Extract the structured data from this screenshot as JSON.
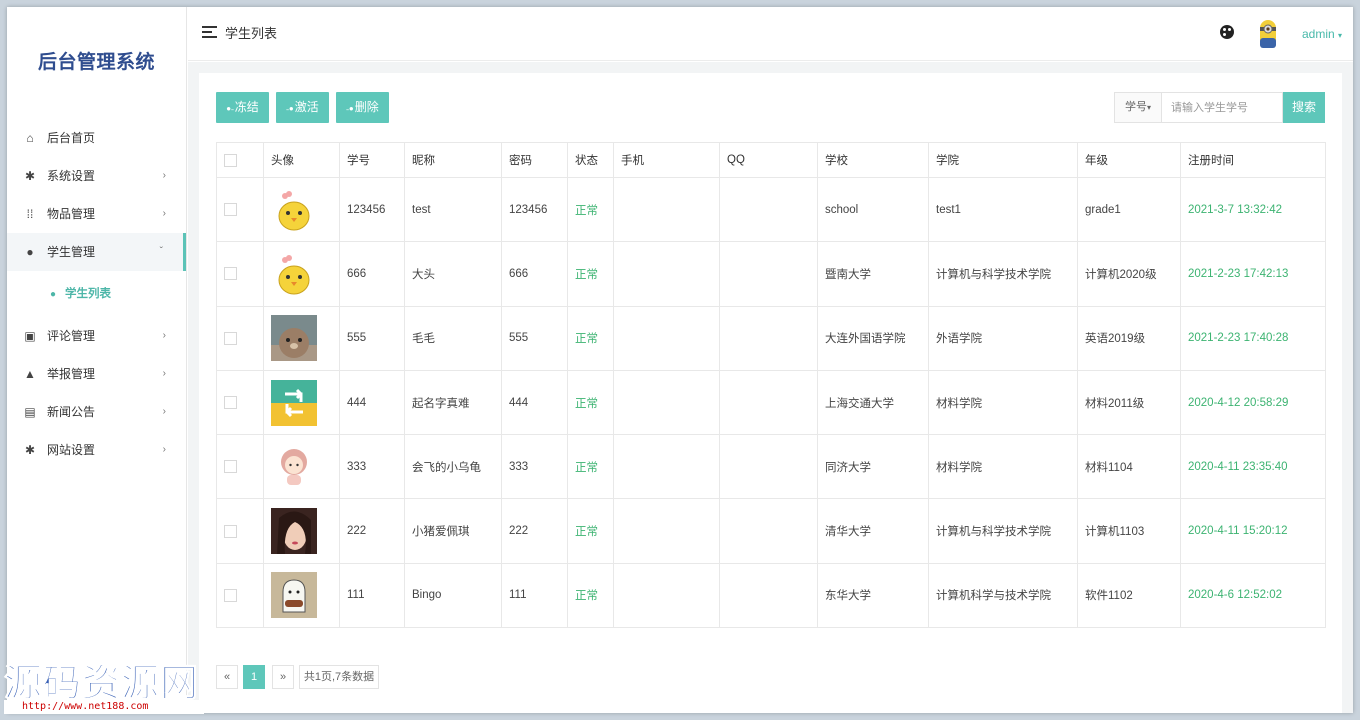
{
  "sidebar": {
    "brand": "后台管理系统",
    "items": [
      {
        "label": "后台首页",
        "icon": "home-icon",
        "glyph": "⌂",
        "arrow": ""
      },
      {
        "label": "系统设置",
        "icon": "gear-icon",
        "glyph": "✱",
        "arrow": "›"
      },
      {
        "label": "物品管理",
        "icon": "grid-icon",
        "glyph": "⁞⁞",
        "arrow": "›"
      },
      {
        "label": "学生管理",
        "icon": "users-icon",
        "glyph": "👥",
        "arrow": "ˇ"
      },
      {
        "label": "评论管理",
        "icon": "comment-icon",
        "glyph": "▣",
        "arrow": "›"
      },
      {
        "label": "举报管理",
        "icon": "warning-icon",
        "glyph": "▲",
        "arrow": "›"
      },
      {
        "label": "新闻公告",
        "icon": "news-icon",
        "glyph": "▤",
        "arrow": "›"
      },
      {
        "label": "网站设置",
        "icon": "gear-icon",
        "glyph": "✱",
        "arrow": "›"
      }
    ],
    "sub_item": {
      "label": "学生列表",
      "icon": "users-icon"
    }
  },
  "header": {
    "title": "学生列表",
    "user": "admin"
  },
  "toolbar": {
    "freeze": "冻结",
    "activate": "激活",
    "delete": "删除"
  },
  "search": {
    "type": "学号",
    "placeholder": "请输入学生学号",
    "button": "搜索"
  },
  "table": {
    "headers": [
      "",
      "头像",
      "学号",
      "昵称",
      "密码",
      "状态",
      "手机",
      "QQ",
      "学校",
      "学院",
      "年级",
      "注册时间"
    ],
    "rows": [
      {
        "avatar": "chick",
        "id": "123456",
        "nickname": "test",
        "password": "123456",
        "status": "正常",
        "phone": "",
        "qq": "",
        "school": "school",
        "college": "test1",
        "grade": "grade1",
        "regtime": "2021-3-7 13:32:42"
      },
      {
        "avatar": "chick",
        "id": "666",
        "nickname": "大头",
        "password": "666",
        "status": "正常",
        "phone": "",
        "qq": "",
        "school": "暨南大学",
        "college": "计算机与科学技术学院",
        "grade": "计算机2020级",
        "regtime": "2021-2-23 17:42:13"
      },
      {
        "avatar": "bear",
        "id": "555",
        "nickname": "毛毛",
        "password": "555",
        "status": "正常",
        "phone": "",
        "qq": "",
        "school": "大连外国语学院",
        "college": "外语学院",
        "grade": "英语2019级",
        "regtime": "2021-2-23 17:40:28"
      },
      {
        "avatar": "arrows",
        "id": "444",
        "nickname": "起名字真难",
        "password": "444",
        "status": "正常",
        "phone": "",
        "qq": "",
        "school": "上海交通大学",
        "college": "材料学院",
        "grade": "材料2011级",
        "regtime": "2020-4-12 20:58:29"
      },
      {
        "avatar": "girl",
        "id": "333",
        "nickname": "会飞的小乌龟",
        "password": "333",
        "status": "正常",
        "phone": "",
        "qq": "",
        "school": "同济大学",
        "college": "材料学院",
        "grade": "材料1104",
        "regtime": "2020-4-11 23:35:40"
      },
      {
        "avatar": "photo",
        "id": "222",
        "nickname": "小猪爱佩琪",
        "password": "222",
        "status": "正常",
        "phone": "",
        "qq": "",
        "school": "清华大学",
        "college": "计算机与科学技术学院",
        "grade": "计算机1103",
        "regtime": "2020-4-11 15:20:12"
      },
      {
        "avatar": "ghost",
        "id": "111",
        "nickname": "Bingo",
        "password": "111",
        "status": "正常",
        "phone": "",
        "qq": "",
        "school": "东华大学",
        "college": "计算机科学与技术学院",
        "grade": "软件1102",
        "regtime": "2020-4-6 12:52:02"
      }
    ]
  },
  "pagination": {
    "prev": "«",
    "current": "1",
    "next": "»",
    "summary": "共1页,7条数据"
  },
  "watermark": {
    "text": "源码资源网",
    "url": "http://www.net188.com"
  },
  "colors": {
    "accent": "#5ec7ba",
    "status": "#3cb371",
    "brand": "#2f4d8f"
  }
}
